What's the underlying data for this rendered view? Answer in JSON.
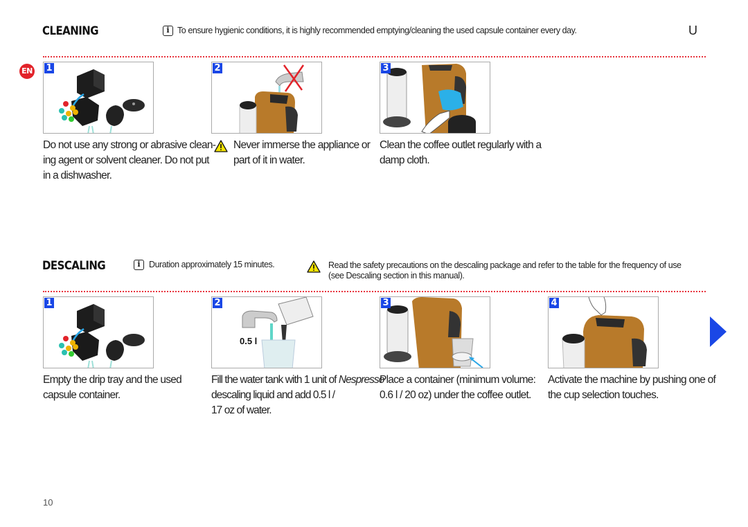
{
  "cleaning": {
    "title": "CLEANING",
    "info_note": "To ensure hygienic conditions, it is highly recommended emptying/cleaning the used capsule container every day.",
    "model_glyph": "U",
    "language_badge": "EN",
    "steps": [
      {
        "number": "1",
        "image": "capsule-container-emptying-illustration",
        "text_lines": [
          "Do not use any strong or abrasive clean-",
          "ing agent or solvent cleaner. Do not put",
          "in a dishwasher."
        ]
      },
      {
        "number": "2",
        "image": "do-not-immerse-machine-illustration",
        "warning": true,
        "text_lines": [
          "Never immerse the appliance or",
          "part of it in water."
        ]
      },
      {
        "number": "3",
        "image": "wipe-coffee-outlet-illustration",
        "text_lines": [
          "Clean the coffee outlet regularly with a",
          "damp cloth."
        ]
      }
    ]
  },
  "descaling": {
    "title": "DESCALING",
    "info_note": "Duration approximately 15 minutes.",
    "warning_note_lines": [
      "Read the safety precautions on the descaling package and refer to the table for the frequency of use",
      "(see Descaling section in this manual)."
    ],
    "steps": [
      {
        "number": "1",
        "image": "empty-drip-tray-illustration",
        "text_lines": [
          "Empty the drip tray and the used",
          "capsule container."
        ]
      },
      {
        "number": "2",
        "image": "fill-water-tank-illustration",
        "image_label": "0.5 l",
        "text_line1_prefix": "Fill the water tank with 1 unit of ",
        "text_line1_brand": "Nespresso",
        "text_lines_rest": [
          "descaling liquid and add 0.5 l /",
          "17 oz of water."
        ]
      },
      {
        "number": "3",
        "image": "place-container-illustration",
        "text_lines": [
          "Place a container (minimum volume:",
          "0.6 l / 20 oz) under the coffee outlet."
        ]
      },
      {
        "number": "4",
        "image": "press-cup-button-illustration",
        "text_lines": [
          "Activate the machine by pushing one of",
          "the cup selection touches."
        ]
      }
    ]
  },
  "footer": {
    "page_number": "10"
  },
  "colors": {
    "accent_blue": "#1a47e6",
    "badge_red": "#e2232a",
    "divider_red": "#e8323c",
    "machine_brown": "#b87a2a"
  }
}
